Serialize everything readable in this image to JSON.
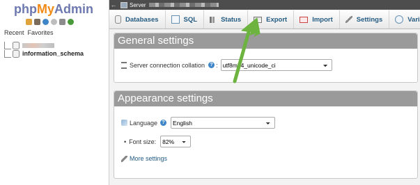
{
  "sidebar": {
    "logo": {
      "php": "php",
      "my": "My",
      "admin": "Admin"
    },
    "recent_label": "Recent",
    "favorites_label": "Favorites",
    "databases": [
      {
        "name": ""
      },
      {
        "name": "information_schema"
      }
    ]
  },
  "topbar": {
    "server_label": "Server"
  },
  "tabs": [
    {
      "label": "Databases",
      "icon": "databases-icon"
    },
    {
      "label": "SQL",
      "icon": "sql-icon"
    },
    {
      "label": "Status",
      "icon": "status-icon"
    },
    {
      "label": "Export",
      "icon": "export-icon"
    },
    {
      "label": "Import",
      "icon": "import-icon"
    },
    {
      "label": "Settings",
      "icon": "settings-icon"
    },
    {
      "label": "Variables",
      "icon": "variables-icon"
    }
  ],
  "general": {
    "title": "General settings",
    "collation_label": "Server connection collation",
    "collation_value": "utf8mb4_unicode_ci"
  },
  "appearance": {
    "title": "Appearance settings",
    "language_label": "Language",
    "language_value": "English",
    "font_label": "Font size:",
    "font_value": "82%",
    "more_label": "More settings"
  },
  "colors": {
    "accent": "#235a81",
    "arrow": "#6db33f"
  }
}
